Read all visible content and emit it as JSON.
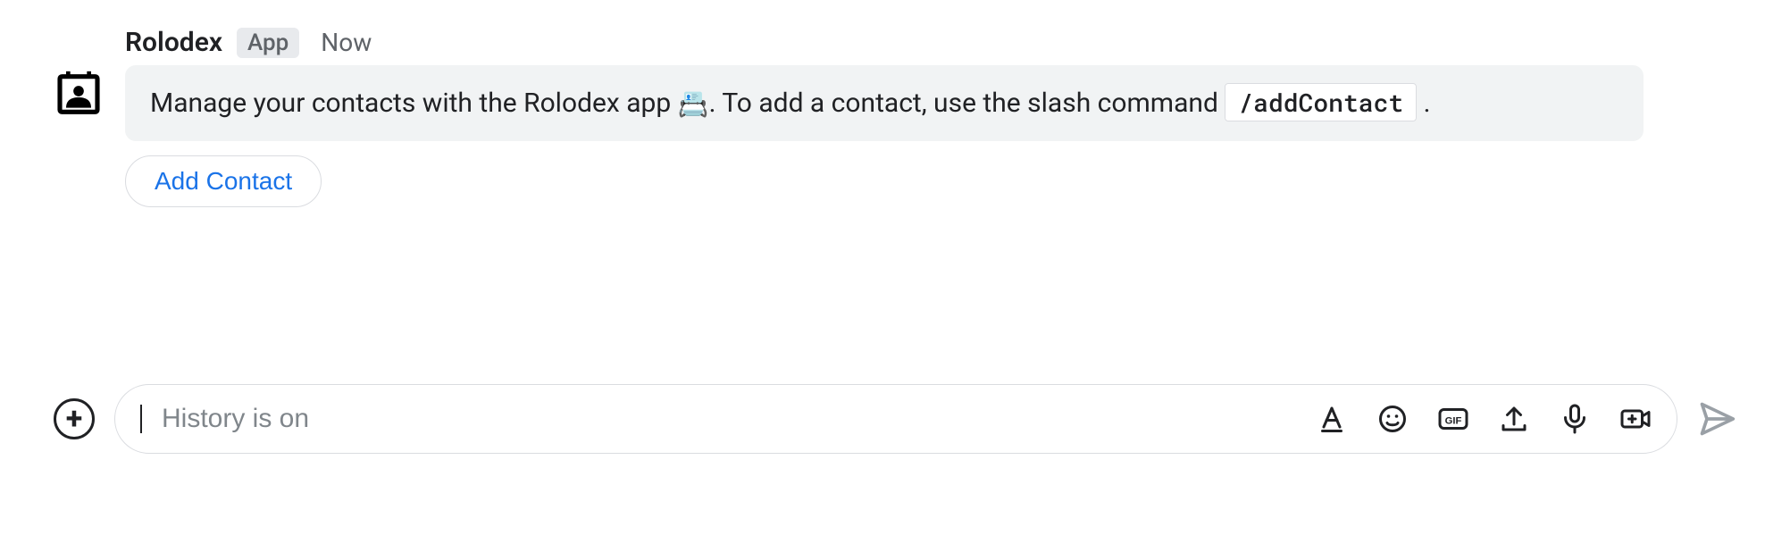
{
  "message": {
    "sender_name": "Rolodex",
    "app_badge": "App",
    "timestamp": "Now",
    "body_part1": "Manage your contacts with the Rolodex app ",
    "emoji": "📇",
    "body_part2": ". To add a contact, use the slash command ",
    "slash_command": "/addContact",
    "body_part3": " .",
    "action_button": "Add Contact"
  },
  "compose": {
    "placeholder": "History is on"
  }
}
